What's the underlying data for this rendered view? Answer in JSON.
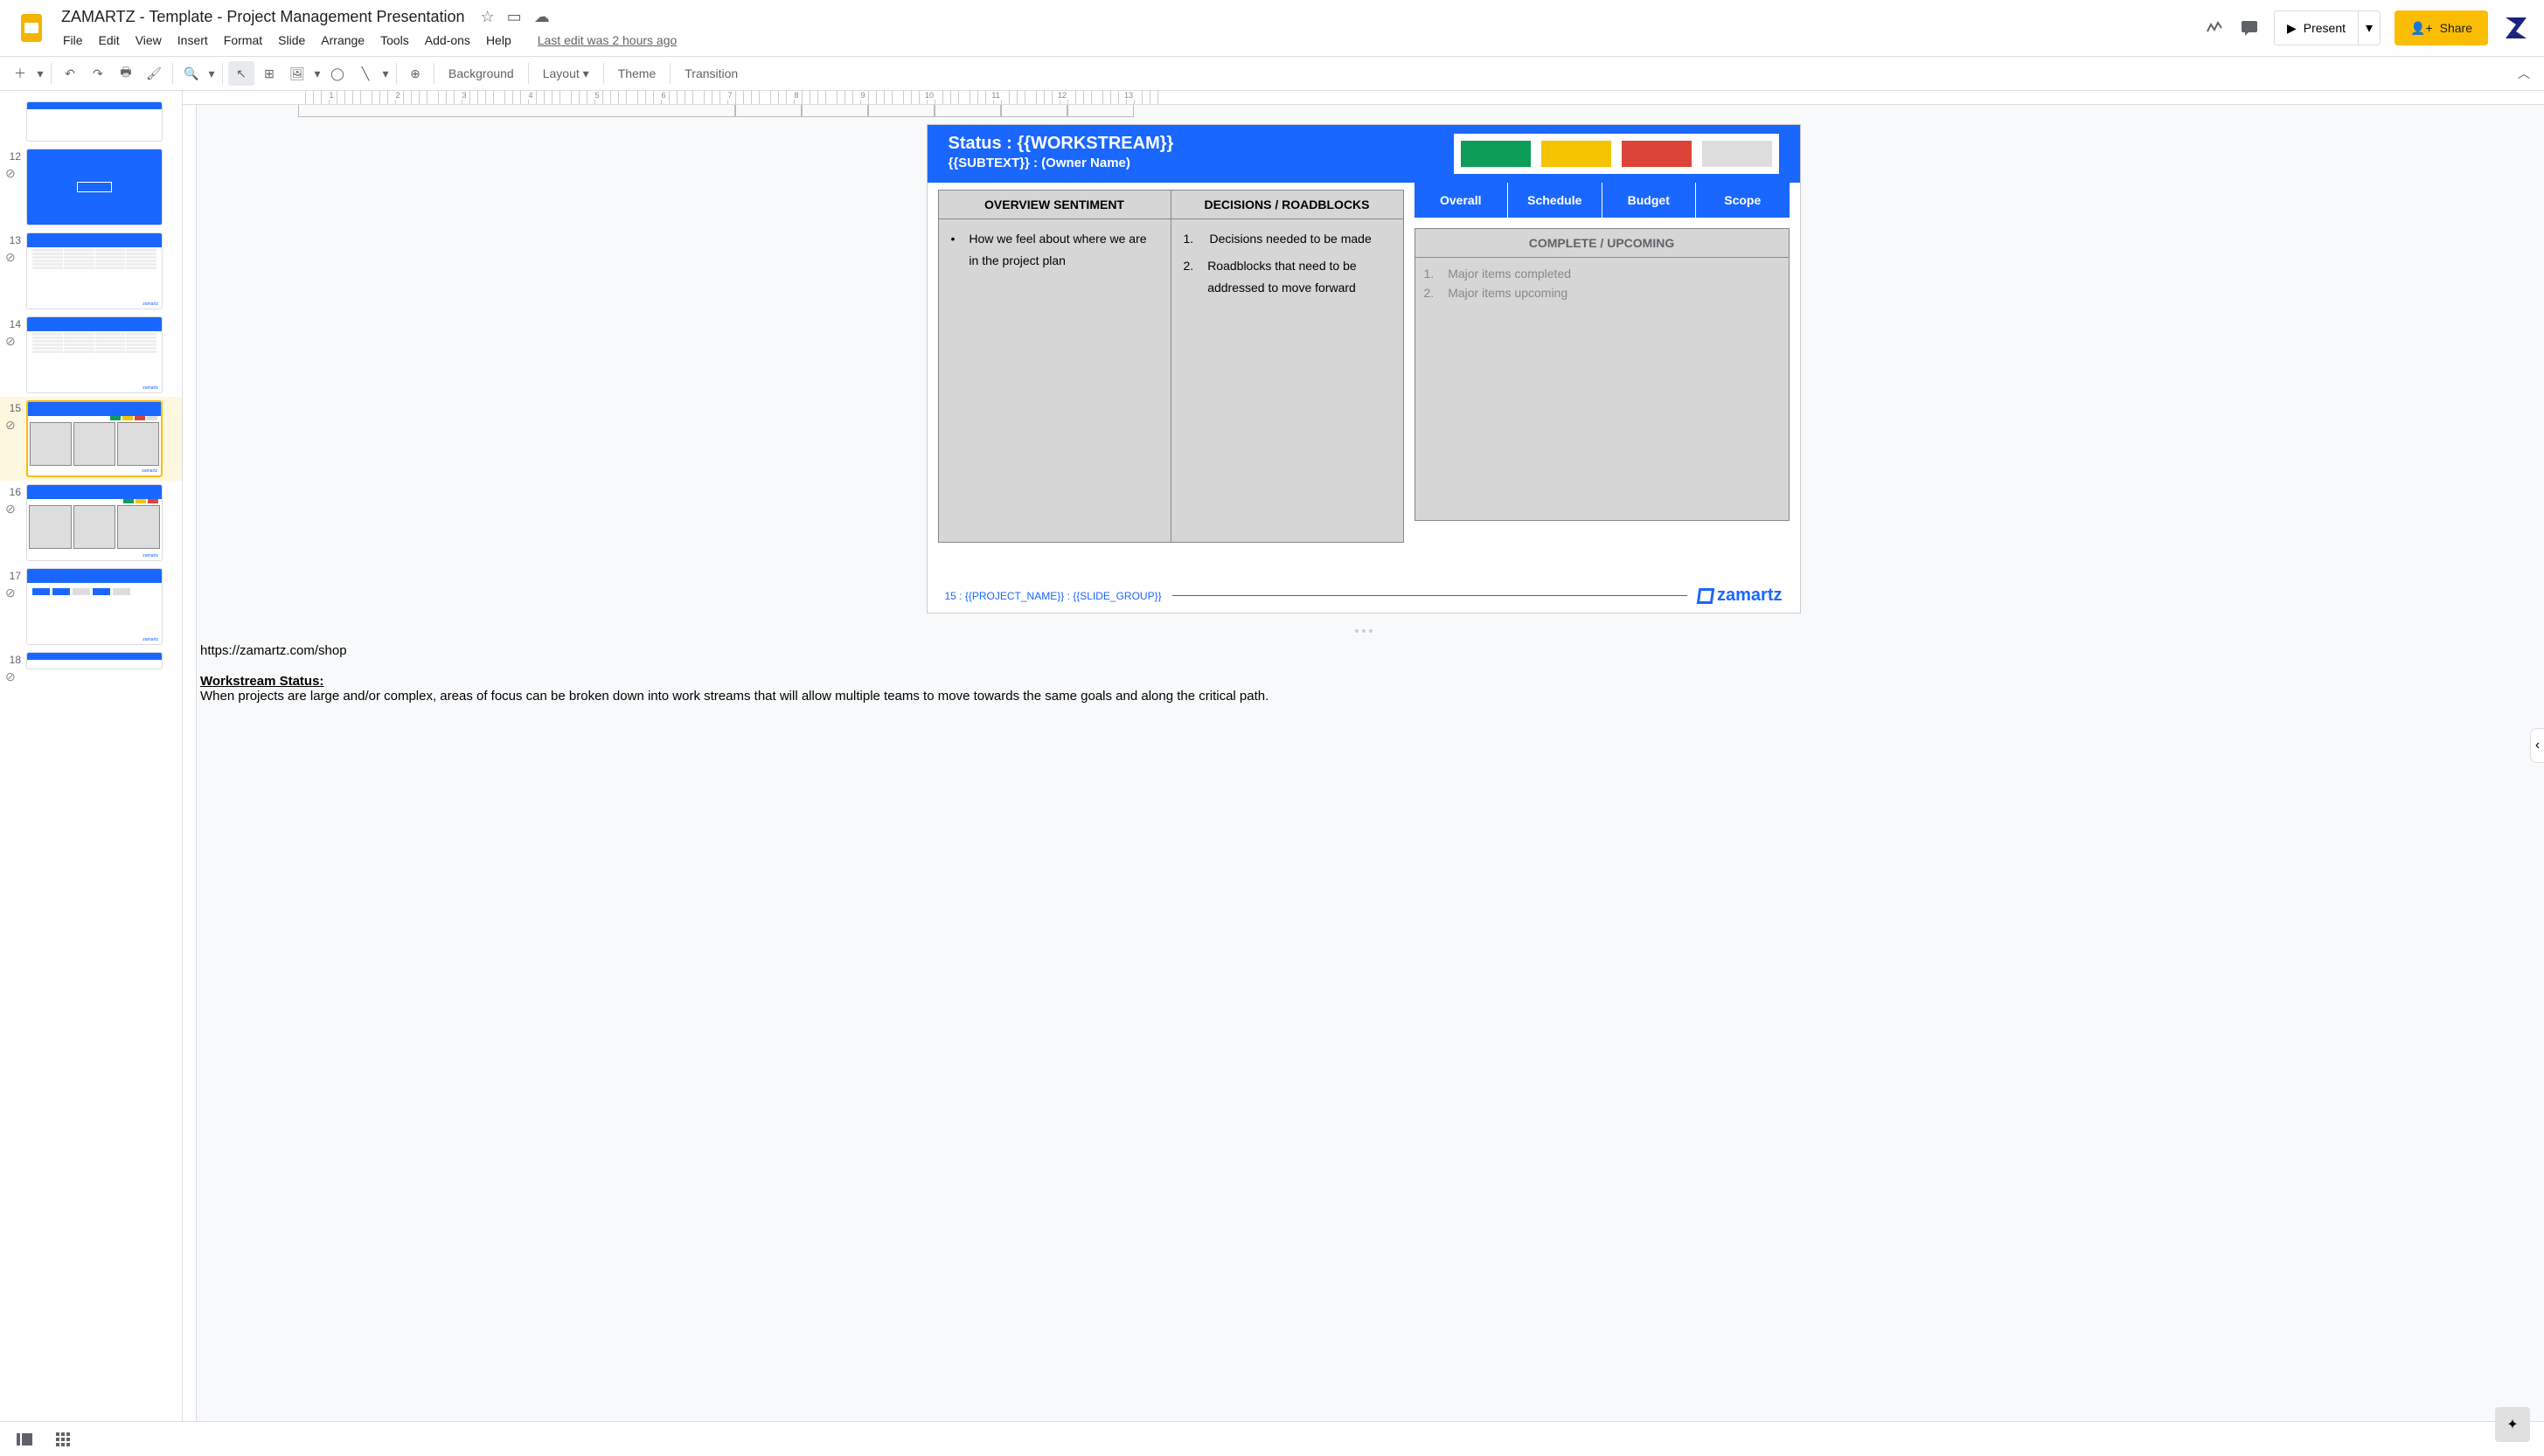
{
  "doc": {
    "title": "ZAMARTZ - Template - Project Management Presentation",
    "last_edit": "Last edit was 2 hours ago"
  },
  "menu": {
    "file": "File",
    "edit": "Edit",
    "view": "View",
    "insert": "Insert",
    "format": "Format",
    "slide": "Slide",
    "arrange": "Arrange",
    "tools": "Tools",
    "addons": "Add-ons",
    "help": "Help"
  },
  "header_buttons": {
    "present": "Present",
    "share": "Share"
  },
  "toolbar": {
    "background": "Background",
    "layout": "Layout",
    "theme": "Theme",
    "transition": "Transition"
  },
  "ruler": [
    "1",
    "2",
    "3",
    "4",
    "5",
    "6",
    "7",
    "8",
    "9",
    "10",
    "11",
    "12",
    "13"
  ],
  "filmstrip": [
    {
      "num": "",
      "type": "partial"
    },
    {
      "num": "12",
      "type": "blue"
    },
    {
      "num": "13",
      "type": "table"
    },
    {
      "num": "14",
      "type": "table"
    },
    {
      "num": "15",
      "type": "status",
      "selected": true
    },
    {
      "num": "16",
      "type": "status2"
    },
    {
      "num": "17",
      "type": "chart"
    },
    {
      "num": "18",
      "type": "partial"
    }
  ],
  "slide": {
    "title": "Status : {{WORKSTREAM}}",
    "subtitle": "{{SUBTEXT}} : (Owner Name)",
    "table_headers": {
      "left": "OVERVIEW SENTIMENT",
      "right": "DECISIONS / ROADBLOCKS"
    },
    "overview_bullet": "How we feel about where we are in the project plan",
    "decisions": [
      {
        "n": "1.",
        "t": "Decisions needed to be made"
      },
      {
        "n": "2.",
        "t": "Roadblocks that need to be addressed to move forward"
      }
    ],
    "status_labels": [
      "Overall",
      "Schedule",
      "Budget",
      "Scope"
    ],
    "complete_header": "COMPLETE / UPCOMING",
    "complete_items": [
      {
        "n": "1.",
        "t": "Major items completed"
      },
      {
        "n": "2.",
        "t": "Major items upcoming"
      }
    ],
    "footer_text": "15 : {{PROJECT_NAME}} : {{SLIDE_GROUP}}",
    "footer_logo": "zamartz"
  },
  "notes": {
    "url": "https://zamartz.com/shop",
    "heading": "Workstream Status:",
    "body": "When projects are large and/or complex, areas of focus can be broken down into work streams that will allow multiple teams to move towards the same goals and along the critical path."
  }
}
